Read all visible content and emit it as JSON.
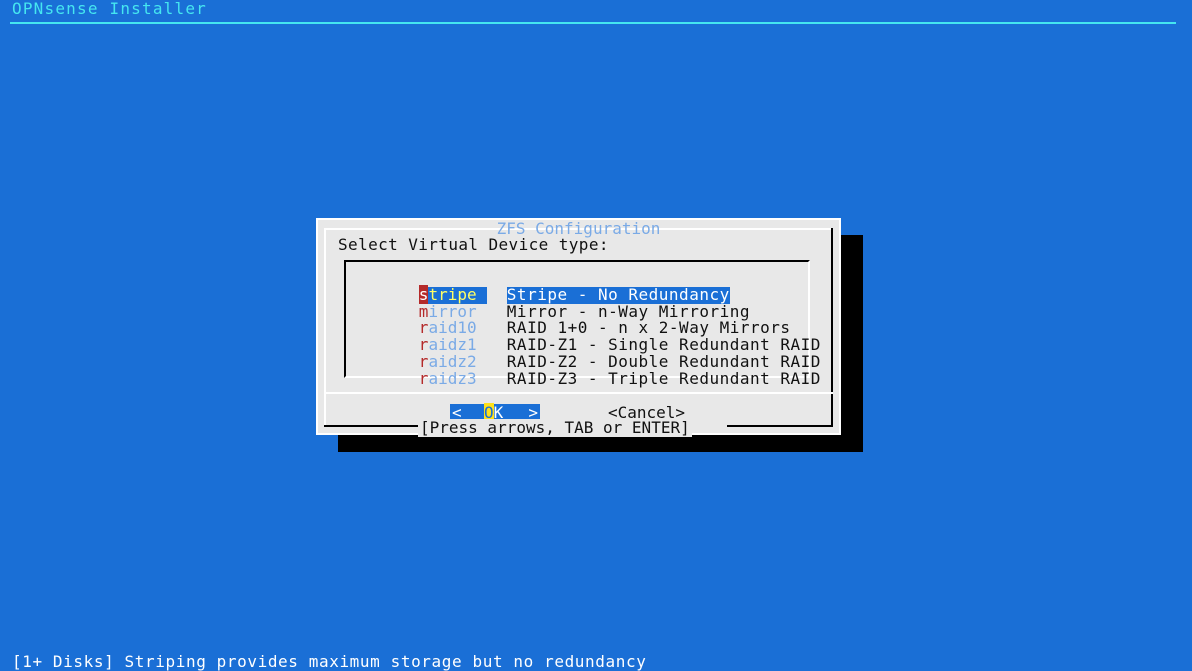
{
  "screen": {
    "backtitle": "OPNsense Installer",
    "status": "[1+ Disks] Striping provides maximum storage but no redundancy"
  },
  "dialog": {
    "title": "ZFS Configuration",
    "prompt": "Select Virtual Device type:",
    "items": [
      {
        "hot": "s",
        "rest": "tripe",
        "desc": "Stripe - No Redundancy",
        "selected": true
      },
      {
        "hot": "m",
        "rest": "irror",
        "desc": "Mirror - n-Way Mirroring",
        "selected": false
      },
      {
        "hot": "r",
        "rest": "aid10",
        "desc": "RAID 1+0 - n x 2-Way Mirrors",
        "selected": false
      },
      {
        "hot": "r",
        "rest": "aidz1",
        "desc": "RAID-Z1 - Single Redundant RAID",
        "selected": false
      },
      {
        "hot": "r",
        "rest": "aidz2",
        "desc": "RAID-Z2 - Double Redundant RAID",
        "selected": false
      },
      {
        "hot": "r",
        "rest": "aidz3",
        "desc": "RAID-Z3 - Triple Redundant RAID",
        "selected": false
      }
    ],
    "buttons": {
      "ok": {
        "open": "<",
        "hot": "O",
        "rest": "K",
        "close": ">"
      },
      "cancel": "<Cancel>"
    },
    "hint": "[Press arrows, TAB or ENTER]"
  },
  "colors": {
    "background": "#1a6fd6",
    "dialog": "#e8e8e8",
    "title": "#45e6f0",
    "hotkey": "#b42a2a",
    "tag": "#7aaae6",
    "ok_hotkey": "#ffe11a"
  }
}
